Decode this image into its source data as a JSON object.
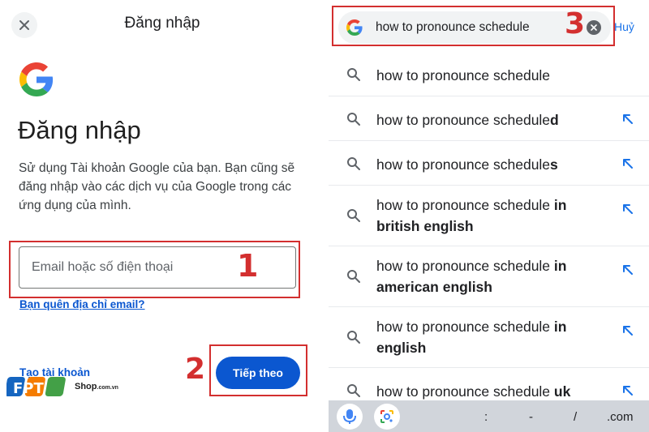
{
  "left_panel": {
    "top_title": "Đăng nhập",
    "heading": "Đăng nhập",
    "description": "Sử dụng Tài khoản Google của bạn. Bạn cũng sẽ đăng nhập vào các dịch vụ của Google trong các ứng dụng của mình.",
    "email_placeholder": "Email hoặc số điện thoại",
    "forgot_email": "Bạn quên địa chỉ email?",
    "create_account": "Tạo tài khoản",
    "next_button": "Tiếp theo"
  },
  "annotations": {
    "step1": "1",
    "step2": "2",
    "step3": "3",
    "color": "#d32f2f"
  },
  "watermark": {
    "brand": "FPT",
    "shop": "Shop",
    "domain": ".com.vn"
  },
  "right_panel": {
    "search_query": "how to pronounce schedule",
    "cancel_label": "Huỷ",
    "suggestions": [
      {
        "prefix": "how to pronounce schedule",
        "suffix": "",
        "second_line": ""
      },
      {
        "prefix": "how to pronounce schedule",
        "suffix": "d",
        "second_line": ""
      },
      {
        "prefix": "how to pronounce schedule",
        "suffix": "s",
        "second_line": ""
      },
      {
        "prefix": "how to pronounce schedule",
        "suffix": " in",
        "second_line": "british english"
      },
      {
        "prefix": "how to pronounce schedule",
        "suffix": " in",
        "second_line": "american english"
      },
      {
        "prefix": "how to pronounce schedule",
        "suffix": " in",
        "second_line": "english"
      },
      {
        "prefix": "how to pronounce schedule",
        "suffix": " uk",
        "second_line": ""
      }
    ],
    "keyboard_keys": [
      ":",
      "-",
      "/",
      ".com"
    ]
  },
  "colors": {
    "accent_blue": "#0b57d0",
    "link_blue": "#1a73e8",
    "annotation_red": "#d32f2f"
  }
}
